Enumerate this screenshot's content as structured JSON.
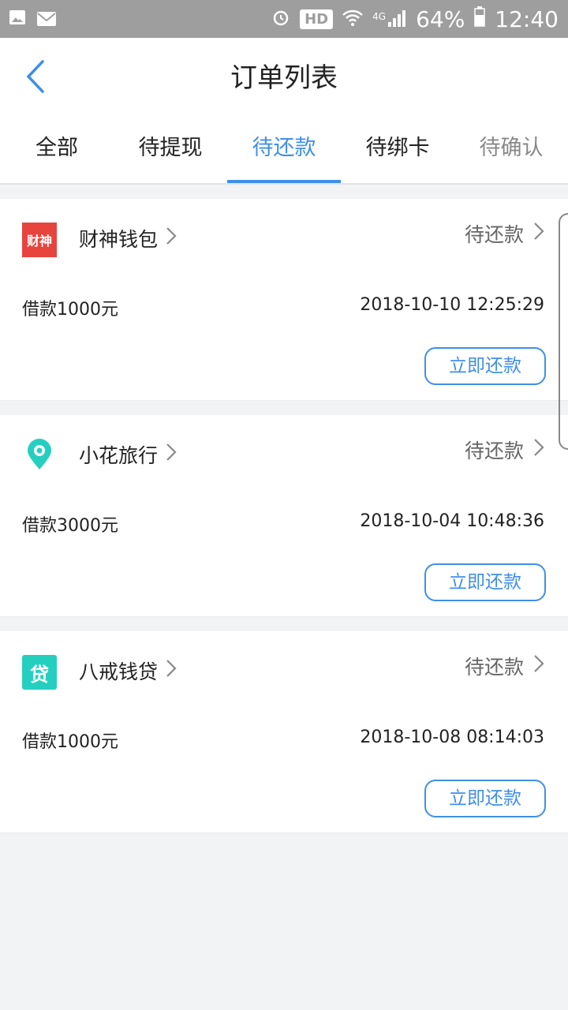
{
  "statusbar": {
    "network": "4G",
    "hd": "HD",
    "battery": "64%",
    "time": "12:40"
  },
  "header": {
    "title": "订单列表"
  },
  "tabs": [
    {
      "label": "全部"
    },
    {
      "label": "待提现"
    },
    {
      "label": "待还款"
    },
    {
      "label": "待绑卡"
    },
    {
      "label": "待确认"
    }
  ],
  "active_tab": "待还款",
  "orders": [
    {
      "logo_text": "财神",
      "logo_color": "#e8443e",
      "name": "财神钱包",
      "status": "待还款",
      "amount": "借款1000元",
      "time": "2018-10-10 12:25:29",
      "action": "立即还款"
    },
    {
      "logo_icon": "map-pin-icon",
      "logo_color": "#25cfc0",
      "name": "小花旅行",
      "status": "待还款",
      "amount": "借款3000元",
      "time": "2018-10-04 10:48:36",
      "action": "立即还款"
    },
    {
      "logo_text": "贷",
      "logo_color": "#25cfc0",
      "name": "八戒钱贷",
      "status": "待还款",
      "amount": "借款1000元",
      "time": "2018-10-08 08:14:03",
      "action": "立即还款"
    }
  ],
  "colors": {
    "accent": "#3f8fe8",
    "statusbar": "#9e9e9e",
    "background": "#f2f3f5"
  }
}
